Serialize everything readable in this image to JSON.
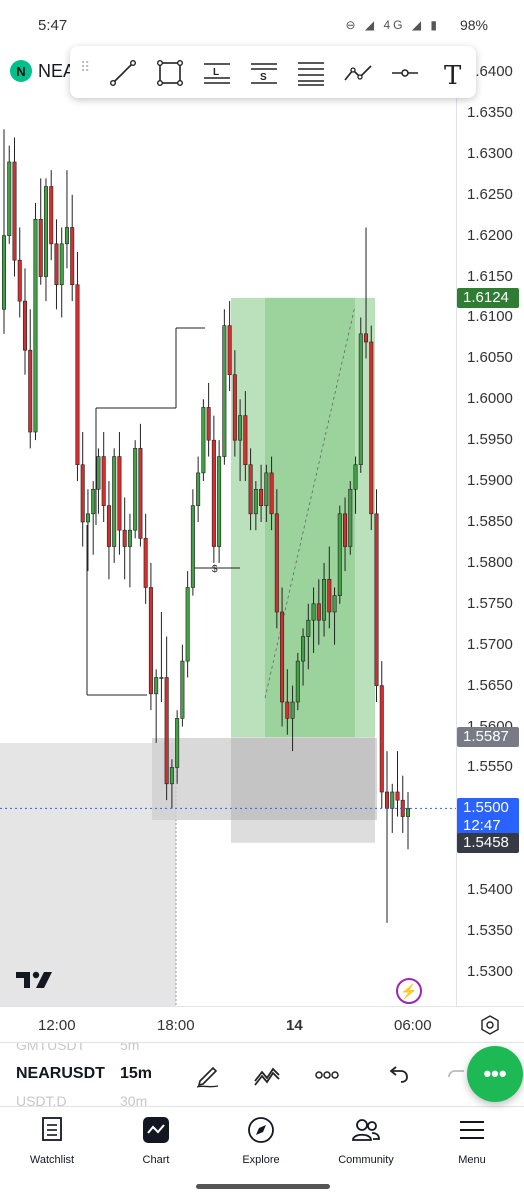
{
  "status": {
    "time": "5:47",
    "network": "4G",
    "battery": "98%"
  },
  "symbol": {
    "short": "NEA",
    "logo_letter": "N",
    "full": "NEARUSDT",
    "interval": "15m"
  },
  "ghost_rows": {
    "above_symbol": "GMTUSDT",
    "above_interval": "5m",
    "below_symbol": "USDT.D",
    "below_interval": "30m"
  },
  "toolbar": {
    "tools": [
      "trend-line",
      "rectangle",
      "long-position",
      "short-position",
      "horizontal-lines",
      "path",
      "horizontal-ray",
      "text"
    ],
    "long_letter": "L",
    "short_letter": "S",
    "text_letter": "T"
  },
  "price_axis": {
    "ticks": [
      "1.6400",
      "1.6350",
      "1.6300",
      "1.6250",
      "1.6200",
      "1.6150",
      "1.6100",
      "1.6050",
      "1.6000",
      "1.5950",
      "1.5900",
      "1.5850",
      "1.5800",
      "1.5750",
      "1.5700",
      "1.5650",
      "1.5600",
      "1.5550",
      "1.5450",
      "1.5400",
      "1.5350",
      "1.5300"
    ],
    "target_label": "1.6124",
    "entry_label": "1.5587",
    "current_label": "1.5500",
    "countdown": "12:47",
    "stop_label": "1.5458"
  },
  "colors": {
    "up": "#26a69a",
    "down": "#c62828",
    "up_fill": "#4caf50",
    "target": "#2e7d32",
    "current": "#2962ff",
    "entry_bg": "#787b86",
    "stop_bg": "#363a45"
  },
  "chart_annotation": "$",
  "time_axis": {
    "ticks": [
      "12:00",
      "18:00",
      "14",
      "06:00"
    ]
  },
  "nav": {
    "watchlist": "Watchlist",
    "chart": "Chart",
    "explore": "Explore",
    "community": "Community",
    "menu": "Menu"
  },
  "fab_label": "•••",
  "chart_data": {
    "type": "candlestick",
    "symbol": "NEARUSDT",
    "interval": "15m",
    "x_ticks": [
      "12:00",
      "18:00",
      "14",
      "06:00"
    ],
    "ylim": [
      1.527,
      1.643
    ],
    "y_ticks": [
      1.64,
      1.635,
      1.63,
      1.625,
      1.62,
      1.615,
      1.61,
      1.605,
      1.6,
      1.595,
      1.59,
      1.585,
      1.58,
      1.575,
      1.57,
      1.565,
      1.56,
      1.555,
      1.545,
      1.54,
      1.535,
      1.53
    ],
    "candles": [
      [
        1.611,
        1.633,
        1.608,
        1.62
      ],
      [
        1.62,
        1.631,
        1.619,
        1.629
      ],
      [
        1.629,
        1.632,
        1.615,
        1.617
      ],
      [
        1.617,
        1.621,
        1.61,
        1.612
      ],
      [
        1.612,
        1.616,
        1.603,
        1.606
      ],
      [
        1.606,
        1.611,
        1.594,
        1.596
      ],
      [
        1.596,
        1.624,
        1.595,
        1.622
      ],
      [
        1.622,
        1.627,
        1.614,
        1.615
      ],
      [
        1.615,
        1.627,
        1.612,
        1.626
      ],
      [
        1.626,
        1.628,
        1.617,
        1.619
      ],
      [
        1.619,
        1.622,
        1.611,
        1.614
      ],
      [
        1.614,
        1.621,
        1.61,
        1.619
      ],
      [
        1.619,
        1.628,
        1.616,
        1.621
      ],
      [
        1.621,
        1.625,
        1.612,
        1.614
      ],
      [
        1.614,
        1.618,
        1.59,
        1.592
      ],
      [
        1.592,
        1.596,
        1.582,
        1.585
      ],
      [
        1.585,
        1.589,
        1.579,
        1.586
      ],
      [
        1.586,
        1.59,
        1.581,
        1.589
      ],
      [
        1.589,
        1.594,
        1.586,
        1.593
      ],
      [
        1.593,
        1.596,
        1.585,
        1.587
      ],
      [
        1.587,
        1.59,
        1.578,
        1.582
      ],
      [
        1.582,
        1.594,
        1.58,
        1.593
      ],
      [
        1.593,
        1.596,
        1.581,
        1.584
      ],
      [
        1.584,
        1.588,
        1.578,
        1.582
      ],
      [
        1.582,
        1.586,
        1.577,
        1.584
      ],
      [
        1.584,
        1.595,
        1.583,
        1.594
      ],
      [
        1.594,
        1.597,
        1.582,
        1.583
      ],
      [
        1.583,
        1.586,
        1.575,
        1.577
      ],
      [
        1.577,
        1.58,
        1.562,
        1.564
      ],
      [
        1.564,
        1.567,
        1.558,
        1.566
      ],
      [
        1.566,
        1.574,
        1.563,
        1.566
      ],
      [
        1.566,
        1.571,
        1.551,
        1.553
      ],
      [
        1.553,
        1.556,
        1.55,
        1.555
      ],
      [
        1.555,
        1.562,
        1.553,
        1.561
      ],
      [
        1.561,
        1.57,
        1.56,
        1.568
      ],
      [
        1.568,
        1.579,
        1.566,
        1.577
      ],
      [
        1.577,
        1.589,
        1.576,
        1.587
      ],
      [
        1.587,
        1.593,
        1.585,
        1.591
      ],
      [
        1.591,
        1.6,
        1.59,
        1.599
      ],
      [
        1.599,
        1.602,
        1.593,
        1.595
      ],
      [
        1.595,
        1.598,
        1.58,
        1.582
      ],
      [
        1.582,
        1.595,
        1.58,
        1.593
      ],
      [
        1.593,
        1.611,
        1.592,
        1.609
      ],
      [
        1.609,
        1.612,
        1.601,
        1.603
      ],
      [
        1.603,
        1.606,
        1.593,
        1.595
      ],
      [
        1.595,
        1.6,
        1.59,
        1.598
      ],
      [
        1.598,
        1.601,
        1.59,
        1.592
      ],
      [
        1.592,
        1.594,
        1.584,
        1.586
      ],
      [
        1.586,
        1.59,
        1.584,
        1.589
      ],
      [
        1.589,
        1.592,
        1.585,
        1.587
      ],
      [
        1.587,
        1.592,
        1.585,
        1.591
      ],
      [
        1.591,
        1.593,
        1.584,
        1.586
      ],
      [
        1.586,
        1.589,
        1.572,
        1.574
      ],
      [
        1.574,
        1.577,
        1.56,
        1.563
      ],
      [
        1.563,
        1.567,
        1.559,
        1.561
      ],
      [
        1.561,
        1.565,
        1.557,
        1.563
      ],
      [
        1.563,
        1.569,
        1.562,
        1.568
      ],
      [
        1.568,
        1.572,
        1.565,
        1.571
      ],
      [
        1.571,
        1.575,
        1.567,
        1.573
      ],
      [
        1.573,
        1.577,
        1.569,
        1.575
      ],
      [
        1.575,
        1.578,
        1.57,
        1.573
      ],
      [
        1.573,
        1.58,
        1.571,
        1.578
      ],
      [
        1.578,
        1.582,
        1.572,
        1.574
      ],
      [
        1.574,
        1.577,
        1.57,
        1.576
      ],
      [
        1.576,
        1.587,
        1.575,
        1.586
      ],
      [
        1.586,
        1.588,
        1.579,
        1.582
      ],
      [
        1.582,
        1.59,
        1.581,
        1.589
      ],
      [
        1.589,
        1.593,
        1.586,
        1.592
      ],
      [
        1.592,
        1.61,
        1.591,
        1.608
      ],
      [
        1.608,
        1.621,
        1.605,
        1.607
      ],
      [
        1.607,
        1.609,
        1.584,
        1.586
      ],
      [
        1.586,
        1.589,
        1.563,
        1.565
      ],
      [
        1.565,
        1.568,
        1.55,
        1.552
      ],
      [
        1.552,
        1.557,
        1.536,
        1.55
      ],
      [
        1.55,
        1.553,
        1.547,
        1.552
      ],
      [
        1.552,
        1.557,
        1.549,
        1.551
      ],
      [
        1.551,
        1.554,
        1.547,
        1.549
      ],
      [
        1.549,
        1.552,
        1.545,
        1.55
      ]
    ],
    "current_price": 1.55,
    "position": {
      "type": "long",
      "entry": 1.5587,
      "target": 1.6124,
      "stop": 1.5458
    }
  }
}
